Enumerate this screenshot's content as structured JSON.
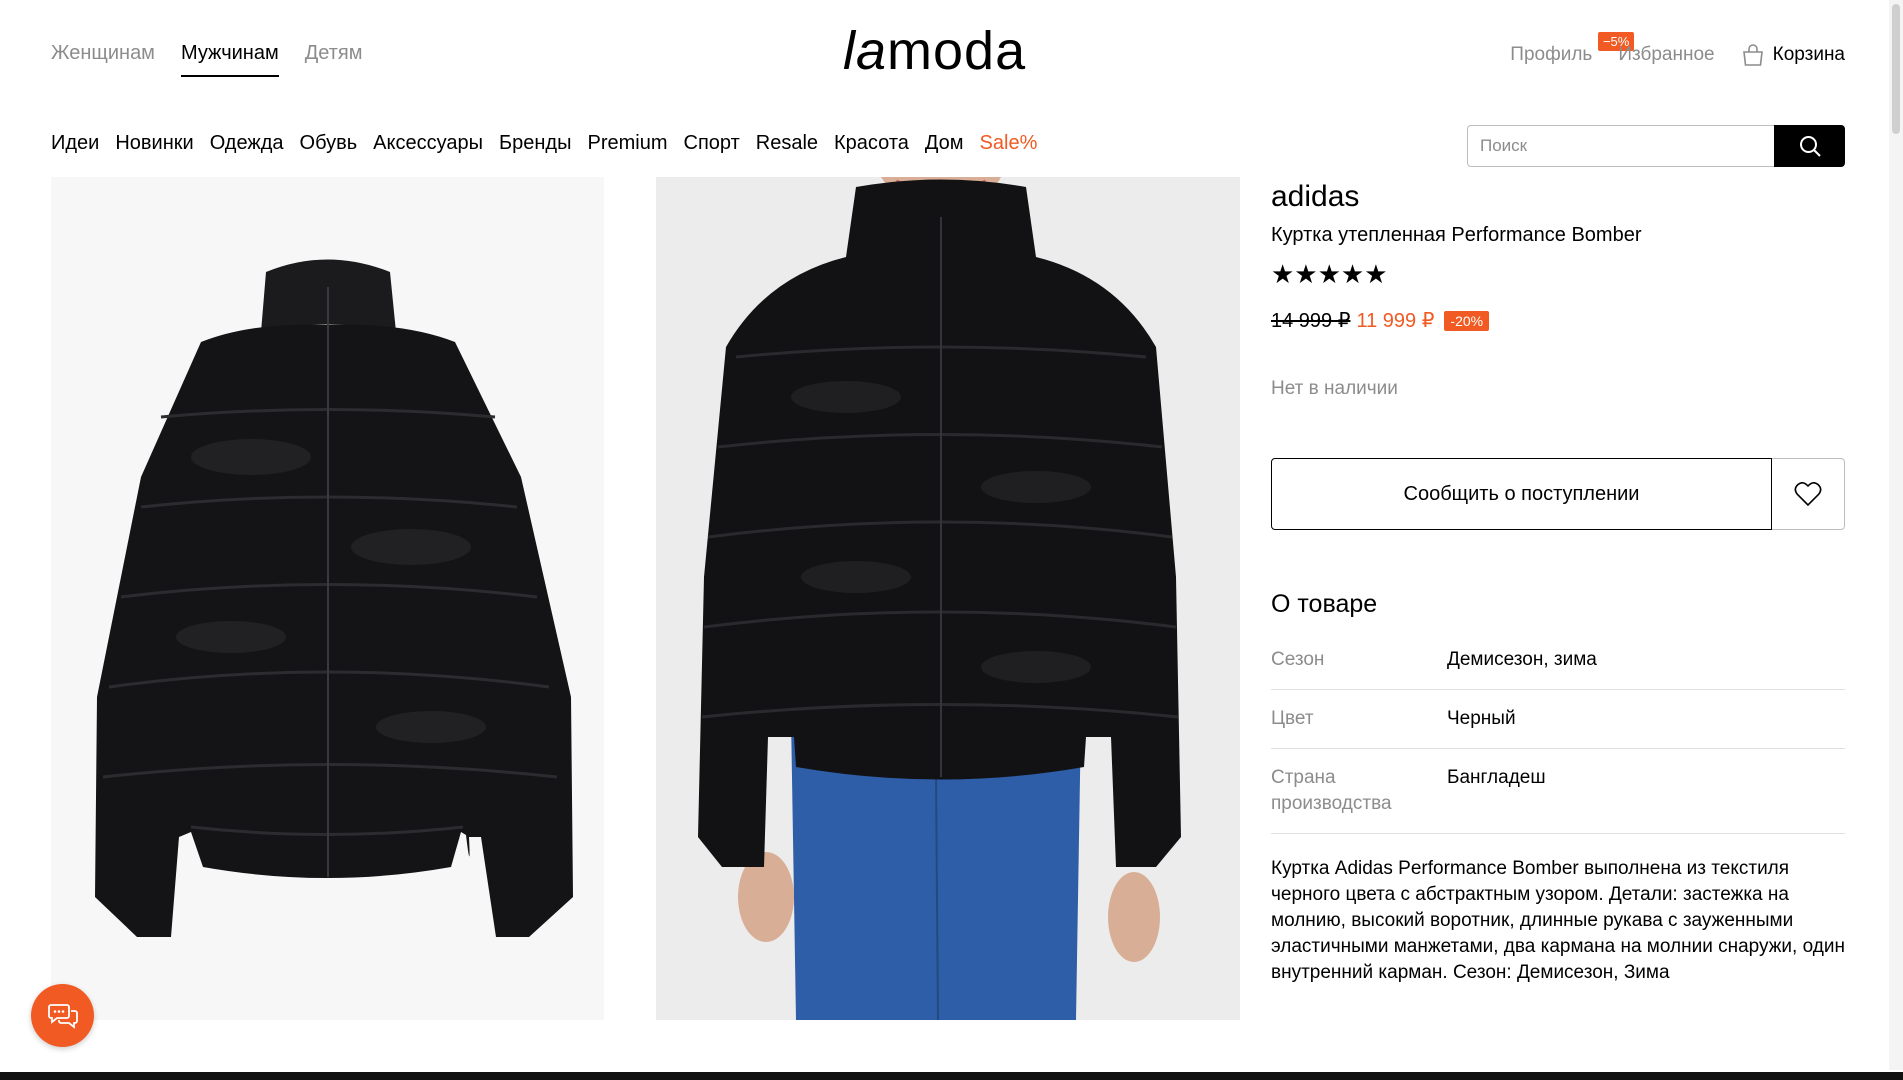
{
  "header": {
    "gender_tabs": [
      "Женщинам",
      "Мужчинам",
      "Детям"
    ],
    "active_gender": "Мужчинам",
    "logo_la": "la",
    "logo_moda": "moda",
    "profile_label": "Профиль",
    "profile_badge": "−5%",
    "favorites_label": "Избранное",
    "cart_label": "Корзина",
    "categories": [
      "Идеи",
      "Новинки",
      "Одежда",
      "Обувь",
      "Аксессуары",
      "Бренды",
      "Premium",
      "Спорт",
      "Resale",
      "Красота",
      "Дом",
      "Sale%"
    ],
    "search_placeholder": "Поиск"
  },
  "product": {
    "brand": "adidas",
    "name": "Куртка утепленная Performance Bomber",
    "rating_stars": "★★★★★",
    "old_price": "14 999 ₽",
    "new_price": "11 999 ₽",
    "discount": "-20%",
    "availability": "Нет в наличии",
    "notify_label": "Сообщить о поступлении",
    "about_title": "О товаре",
    "attributes": [
      {
        "key": "Сезон",
        "value": "Демисезон, зима"
      },
      {
        "key": "Цвет",
        "value": "Черный"
      },
      {
        "key": "Страна производства",
        "value": "Бангладеш"
      }
    ],
    "description": "Куртка Adidas Performance Bomber выполнена из текстиля черного цвета с абстрактным узором. Детали: застежка на молнию, высокий воротник, длинные рукава с зауженными эластичными манжетами, два кармана на молнии снаружи, один внутренний карман. Сезон: Демисезон, Зима"
  },
  "colors": {
    "accent": "#f15a22",
    "muted": "#8c8c8c"
  }
}
